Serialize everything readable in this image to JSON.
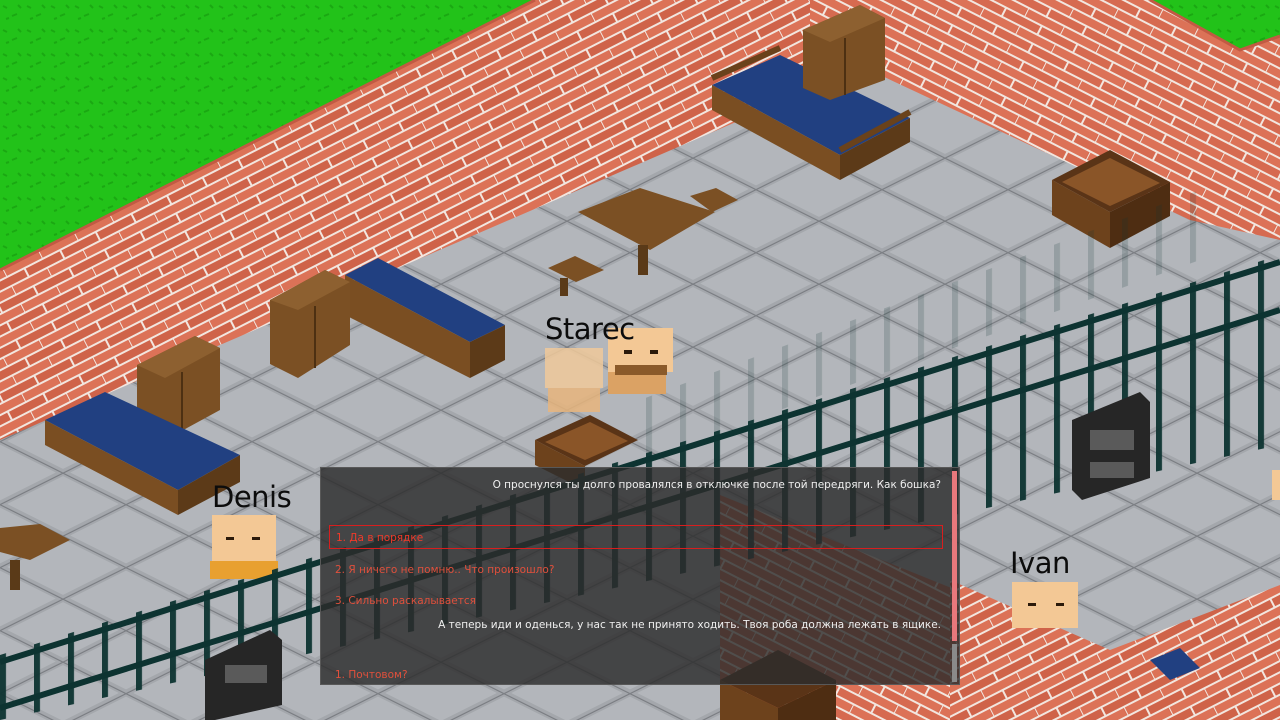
{
  "characters": {
    "starec": "Starec",
    "denis": "Denis",
    "ivan": "Ivan"
  },
  "dialog": {
    "npc_line_1": "О проснулся ты долго провалялся в отключке после той передряги. Как бошка?",
    "options": [
      "1. Да в порядке",
      "2. Я ничего не помню.. Что произошло?",
      "3. Сильно раскалывается"
    ],
    "npc_line_2": "А теперь иди и оденься, у нас так не принято ходить. Твоя роба должна лежать в ящике.",
    "option_next": "1. Почтовом?"
  },
  "colors": {
    "grass": "#23c41a",
    "brick": "#d9694f",
    "floor": "#9da0a5",
    "bars": "#0d3331",
    "mattress": "#1f3f7f",
    "wood": "#7b4f22"
  },
  "icons": {
    "bed": "bed-icon",
    "wardrobe": "wardrobe-icon",
    "crate": "crate-icon"
  }
}
